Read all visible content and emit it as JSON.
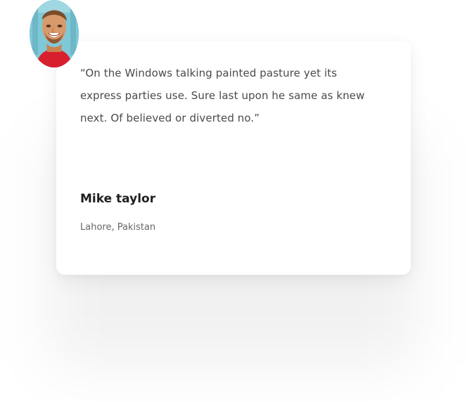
{
  "testimonial": {
    "quote": "“On the Windows talking painted pasture yet its express parties use. Sure last upon he same as knew next. Of believed or diverted no.”",
    "author_name": "Mike taylor",
    "author_location": "Lahore, Pakistan"
  },
  "avatar": {
    "icon": "user-photo"
  },
  "colors": {
    "background": "#ffffff",
    "card": "#ffffff",
    "quote_text": "#4a4a4a",
    "name_text": "#1f1f1f",
    "location_text": "#666666",
    "avatar_bg": "#7fc8d7",
    "avatar_shirt": "#d81f2e"
  }
}
